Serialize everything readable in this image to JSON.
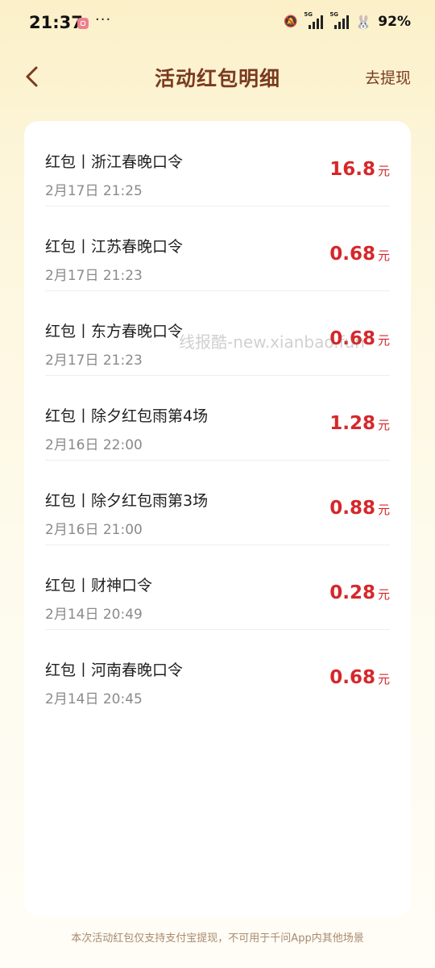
{
  "status_bar": {
    "time": "21:37",
    "dots": "···",
    "network_1": "5G",
    "network_2": "5G",
    "battery": "92%"
  },
  "header": {
    "title": "活动红包明细",
    "action": "去提现"
  },
  "records": [
    {
      "title": "红包丨浙江春晚口令",
      "time": "2月17日 21:25",
      "amount": "16.8",
      "unit": "元"
    },
    {
      "title": "红包丨江苏春晚口令",
      "time": "2月17日 21:23",
      "amount": "0.68",
      "unit": "元"
    },
    {
      "title": "红包丨东方春晚口令",
      "time": "2月17日 21:23",
      "amount": "0.68",
      "unit": "元"
    },
    {
      "title": "红包丨除夕红包雨第4场",
      "time": "2月16日 22:00",
      "amount": "1.28",
      "unit": "元"
    },
    {
      "title": "红包丨除夕红包雨第3场",
      "time": "2月16日 21:00",
      "amount": "0.88",
      "unit": "元"
    },
    {
      "title": "红包丨财神口令",
      "time": "2月14日 20:49",
      "amount": "0.28",
      "unit": "元"
    },
    {
      "title": "红包丨河南春晚口令",
      "time": "2月14日 20:45",
      "amount": "0.68",
      "unit": "元"
    }
  ],
  "watermark": "线报酷-new.xianbao.fun",
  "footer": "本次活动红包仅支持支付宝提现，不可用于千问App内其他场景",
  "colors": {
    "amount": "#d6272b",
    "title": "#7a3a1f",
    "background_top": "#fbf0c8"
  }
}
